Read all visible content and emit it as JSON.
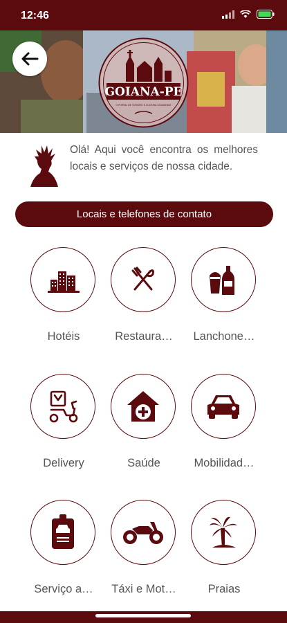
{
  "status": {
    "time": "12:46"
  },
  "hero": {
    "logo_title": "GOIANA-PE",
    "logo_subtitle": "O PORTAL DE TURISMO E CULTURA GOIANENSE"
  },
  "intro": {
    "text": "Olá! Aqui você encontra os melhores locais e serviços de nossa cidade."
  },
  "contact": {
    "label": "Locais e telefones de contato"
  },
  "categories": [
    {
      "label": "Hotéis",
      "icon": "hotel-icon"
    },
    {
      "label": "Restaura…",
      "icon": "restaurant-icon"
    },
    {
      "label": "Lanchone…",
      "icon": "snack-bar-icon"
    },
    {
      "label": "Delivery",
      "icon": "delivery-icon"
    },
    {
      "label": "Saúde",
      "icon": "health-icon"
    },
    {
      "label": "Mobilidad…",
      "icon": "car-icon"
    },
    {
      "label": "Serviço a…",
      "icon": "id-badge-icon"
    },
    {
      "label": "Táxi e Mot…",
      "icon": "motorcycle-icon"
    },
    {
      "label": "Praias",
      "icon": "palm-tree-icon"
    }
  ],
  "colors": {
    "brand": "#5b0a0e",
    "text": "#555555"
  }
}
